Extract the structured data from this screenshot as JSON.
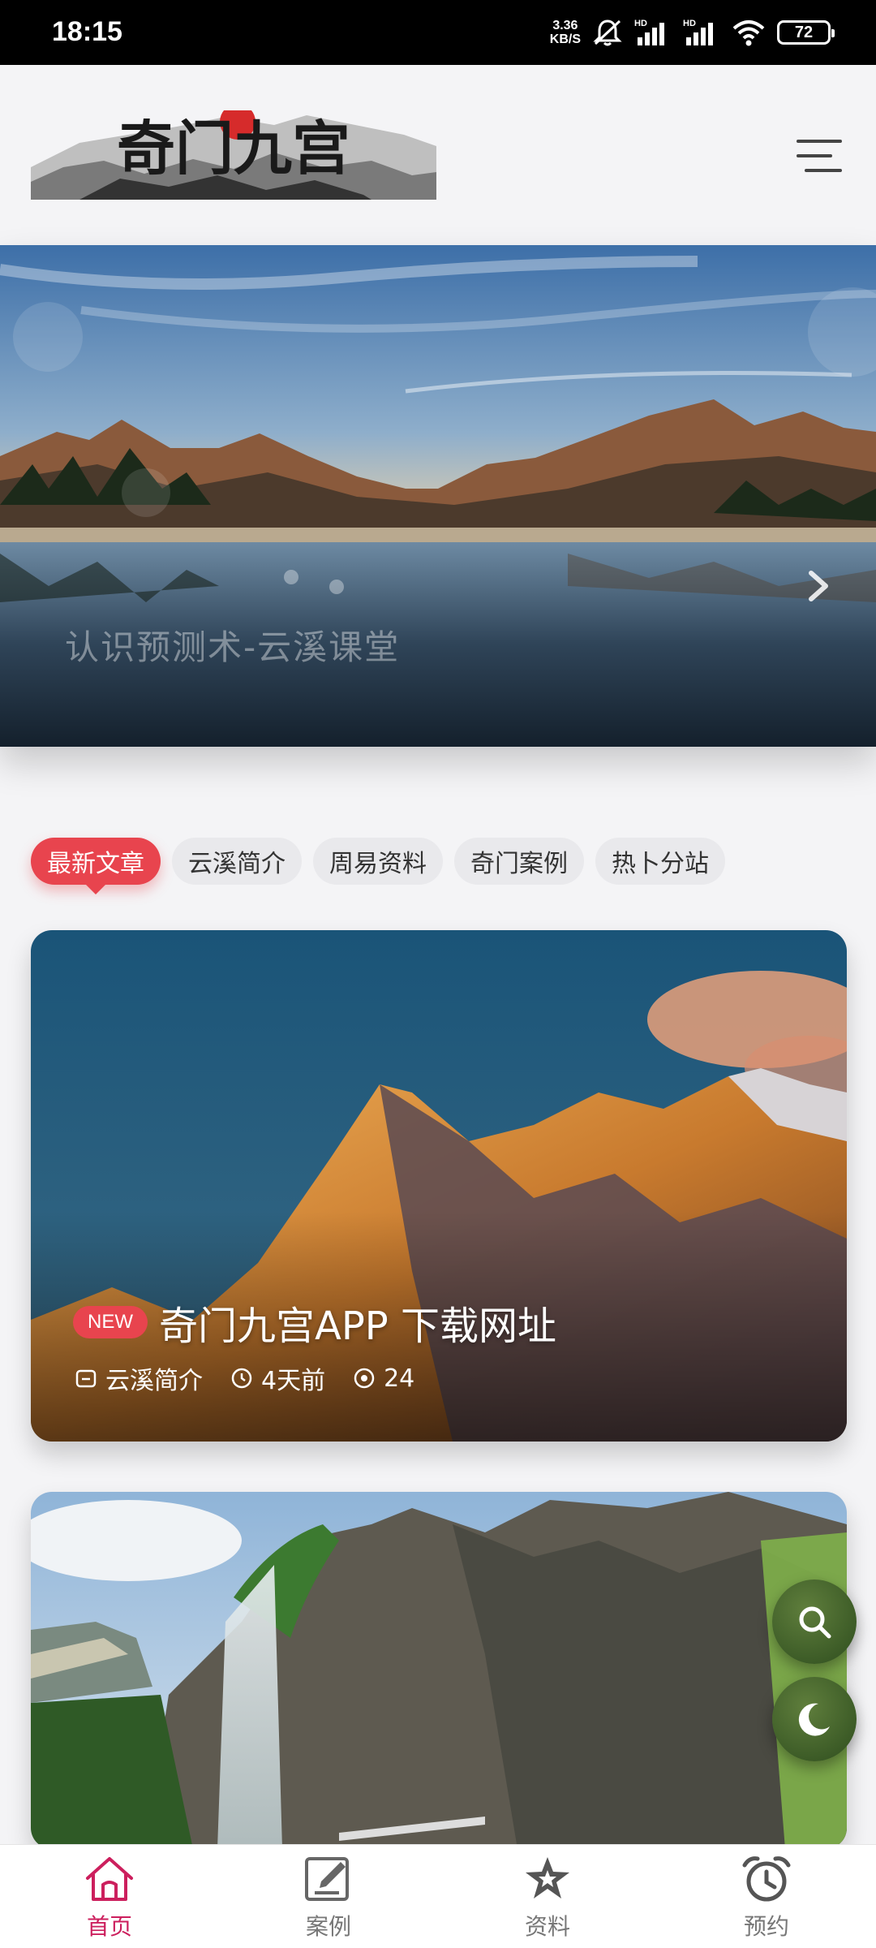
{
  "status_bar": {
    "time": "18:15",
    "net_speed_value": "3.36",
    "net_speed_unit": "KB/S",
    "battery": "72",
    "icons": [
      "mute-icon",
      "signal-hd-icon",
      "signal-hd-icon",
      "wifi-icon",
      "battery-icon"
    ]
  },
  "header": {
    "logo_text": "奇门九宫",
    "menu_icon": "hamburger-menu-icon"
  },
  "hero": {
    "caption": "认识预测术-云溪课堂",
    "next_icon": "chevron-right-icon"
  },
  "tabs": [
    {
      "label": "最新文章",
      "active": true
    },
    {
      "label": "云溪简介",
      "active": false
    },
    {
      "label": "周易资料",
      "active": false
    },
    {
      "label": "奇门案例",
      "active": false
    },
    {
      "label": "热卜分站",
      "active": false
    }
  ],
  "articles": [
    {
      "badge": "NEW",
      "title": "奇门九宫APP 下载网址",
      "category": "云溪简介",
      "time": "4天前",
      "views": "24"
    }
  ],
  "fabs": {
    "search_icon": "search-icon",
    "theme_icon": "moon-icon"
  },
  "bottom_nav": [
    {
      "label": "首页",
      "icon": "home-icon",
      "active": true
    },
    {
      "label": "案例",
      "icon": "edit-icon",
      "active": false
    },
    {
      "label": "资料",
      "icon": "star-icon",
      "active": false
    },
    {
      "label": "预约",
      "icon": "alarm-clock-icon",
      "active": false
    }
  ],
  "colors": {
    "accent": "#e8444e",
    "nav_active": "#cc1f5d",
    "fab": "#3f6228"
  }
}
